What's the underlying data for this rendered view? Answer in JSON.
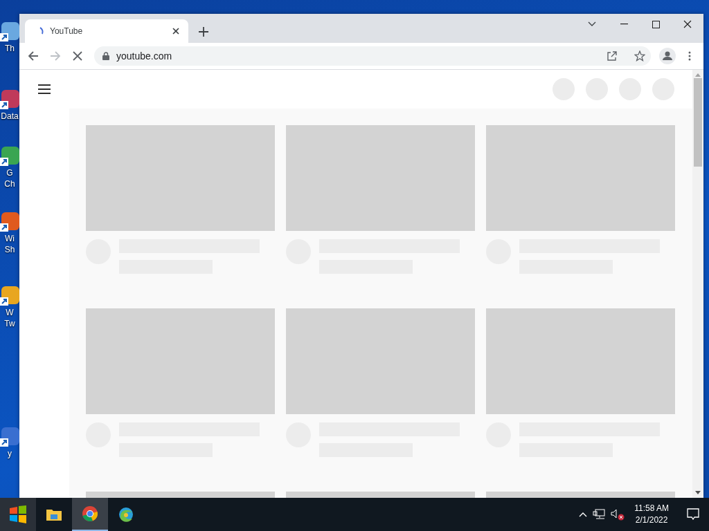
{
  "desktop_icons": [
    {
      "lines": [
        "Th"
      ]
    },
    {
      "lines": [
        "Data"
      ]
    },
    {
      "lines": [
        "G",
        "Ch"
      ]
    },
    {
      "lines": [
        "Wi",
        "Sh"
      ]
    },
    {
      "lines": [
        "W",
        "Tw"
      ]
    },
    {
      "lines": [
        "y"
      ]
    }
  ],
  "browser": {
    "tab": {
      "title": "YouTube"
    },
    "loading": true,
    "url": "youtube.com"
  },
  "taskbar": {
    "apps": [
      {
        "kind": "explorer",
        "selected": false
      },
      {
        "kind": "chrome",
        "selected": true
      },
      {
        "kind": "edge",
        "selected": false
      }
    ],
    "volume_muted": true,
    "time": "11:58 AM",
    "date": "2/1/2022"
  }
}
